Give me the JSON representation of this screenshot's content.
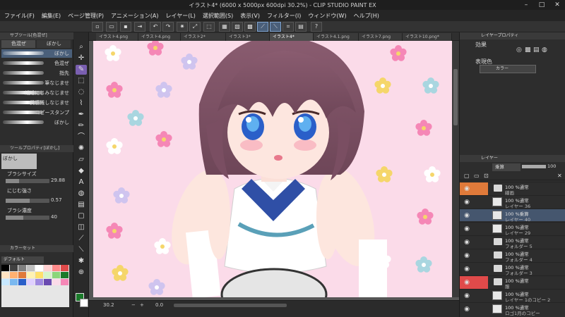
{
  "window": {
    "title": "イラスト4* (6000 x 5000px 600dpi 30.2%) - CLIP STUDIO PAINT EX"
  },
  "menu": [
    "ファイル(F)",
    "編集(E)",
    "ページ管理(P)",
    "アニメーション(A)",
    "レイヤー(L)",
    "選択範囲(S)",
    "表示(V)",
    "フィルター(I)",
    "ウィンドウ(W)",
    "ヘルプ(H)"
  ],
  "tabs": [
    {
      "label": "イラスト4.png",
      "active": false
    },
    {
      "label": "イラスト4.png",
      "active": false
    },
    {
      "label": "イラスト2*",
      "active": false
    },
    {
      "label": "イラスト3*",
      "active": false
    },
    {
      "label": "イラスト4*",
      "active": true
    },
    {
      "label": "イラスト4.1.png",
      "active": false
    },
    {
      "label": "イラスト7.png",
      "active": false
    },
    {
      "label": "イラスト10.png*",
      "active": false
    }
  ],
  "subtool": {
    "header": "サブツール[色混ぜ]",
    "tab_blend": "色混ぜ",
    "tab_blur": "ぼかし",
    "brushes": [
      "ぼかし",
      "色混ぜ",
      "指先",
      "筆なじませ",
      "繊維にじみなじませ",
      "質感残しなじませ",
      "コピースタンプ",
      "ぼかし"
    ]
  },
  "tool_property": {
    "header": "ツールプロパティ[ぼかし]",
    "name": "ぼかし",
    "brush_size_label": "ブラシサイズ",
    "brush_size_value": "29.88",
    "blur_strength_label": "にじむ強さ",
    "blur_strength_value": "0.57",
    "brush_density_label": "ブラシ濃度",
    "brush_density_value": "40",
    "brush_size_fraction": 0.3,
    "blur_strength_fraction": 0.55,
    "brush_density_fraction": 0.4
  },
  "color_set": {
    "header": "カラーセット",
    "set_name": "デフォルト"
  },
  "layer_property": {
    "header": "レイヤープロパティ",
    "effect_label": "効果",
    "expression_color_label": "表現色",
    "expression_color_value": "カラー"
  },
  "layers_panel": {
    "header": "レイヤー",
    "blend_mode": "乗算",
    "opacity": "100",
    "layers": [
      {
        "mode": "100 %通常",
        "name": "線画",
        "type": "folder",
        "color": "#e07a3a"
      },
      {
        "mode": "100 %通常",
        "name": "レイヤー 36",
        "type": "layer",
        "color": ""
      },
      {
        "mode": "100 %乗算",
        "name": "レイヤー 40",
        "type": "layer",
        "color": "",
        "selected": true
      },
      {
        "mode": "100 %通常",
        "name": "レイヤー 29",
        "type": "layer",
        "color": ""
      },
      {
        "mode": "100 %通常",
        "name": "フォルダー 5",
        "type": "folder",
        "color": ""
      },
      {
        "mode": "100 %通常",
        "name": "フォルダー 4",
        "type": "folder",
        "color": ""
      },
      {
        "mode": "100 %通常",
        "name": "フォルダー 3",
        "type": "folder",
        "color": ""
      },
      {
        "mode": "100 %通常",
        "name": "服",
        "type": "folder",
        "color": "#e04a4a"
      },
      {
        "mode": "100 %通常",
        "name": "レイヤー 1のコピー 2",
        "type": "layer",
        "color": ""
      },
      {
        "mode": "100 %通常",
        "name": "ロゴ1月のコピー",
        "type": "layer",
        "color": ""
      }
    ]
  },
  "status": {
    "zoom": "30.2",
    "angle": "0.0"
  },
  "colors": {
    "accent_orange": "#e07a3a",
    "accent_red": "#e04a4a",
    "canvas_bg": "#fbdbe9",
    "main_color": "#1a7a2a",
    "sub_color": "#ffffff"
  }
}
